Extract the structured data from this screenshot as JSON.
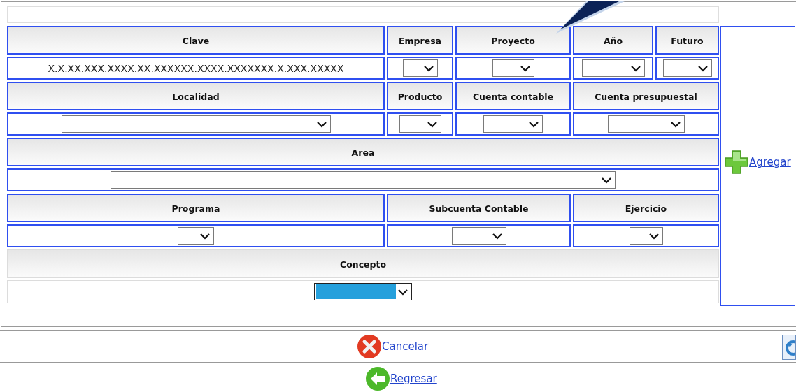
{
  "sections": [
    {
      "outlined": true,
      "fields": [
        {
          "label": "Clave",
          "kind": "text",
          "value": "X.X.XX.XXX.XXXX.XX.XXXXXX.XXXX.XXXXXXX.X.XXX.XXXXX"
        },
        {
          "label": "Empresa",
          "kind": "select"
        },
        {
          "label": "Proyecto",
          "kind": "select"
        },
        {
          "label": "Año",
          "kind": "select"
        },
        {
          "label": "Futuro",
          "kind": "select"
        }
      ]
    },
    {
      "outlined": true,
      "fields": [
        {
          "label": "Localidad",
          "kind": "select"
        },
        {
          "label": "Producto",
          "kind": "select"
        },
        {
          "label": "Cuenta contable",
          "kind": "select"
        },
        {
          "label": "Cuenta presupuestal",
          "kind": "select"
        }
      ]
    },
    {
      "outlined": true,
      "fields": [
        {
          "label": "Area",
          "kind": "select"
        }
      ]
    },
    {
      "outlined": true,
      "fields": [
        {
          "label": "Programa",
          "kind": "select"
        },
        {
          "label": "Subcuenta Contable",
          "kind": "select"
        },
        {
          "label": "Ejercicio",
          "kind": "select"
        }
      ]
    },
    {
      "outlined": false,
      "fields": [
        {
          "label": "Concepto",
          "kind": "select",
          "focused": true
        }
      ]
    }
  ],
  "add_link": "Agregar",
  "cancel_link": "Cancelar",
  "back_link": "Regresar"
}
